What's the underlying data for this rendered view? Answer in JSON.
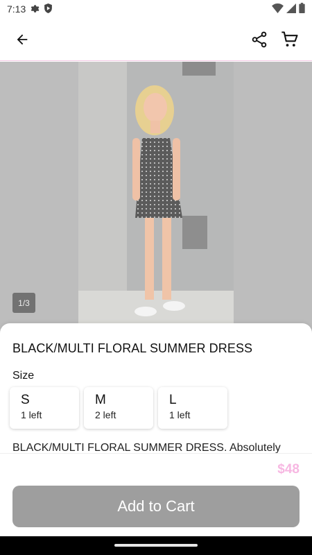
{
  "status_bar": {
    "time": "7:13",
    "icons": [
      "gear-icon",
      "shield-play-icon",
      "wifi-icon",
      "signal-icon",
      "battery-icon"
    ]
  },
  "app_bar": {
    "back_icon": "arrow-left-icon",
    "share_icon": "share-icon",
    "cart_icon": "cart-icon"
  },
  "gallery": {
    "counter": "1/3"
  },
  "product": {
    "title": "BLACK/MULTI FLORAL SUMMER DRESS",
    "size_label": "Size",
    "sizes": [
      {
        "code": "S",
        "stock": "1 left"
      },
      {
        "code": "M",
        "stock": "2 left"
      },
      {
        "code": "L",
        "stock": "1 left"
      }
    ],
    "description": "BLACK/MULTI FLORAL SUMMER DRESS. Absolutely"
  },
  "footer": {
    "price": "$48",
    "add_to_cart": "Add to Cart"
  },
  "colors": {
    "price": "#f7b7e2",
    "button": "#9e9e9e",
    "divider": "#f3c7e3"
  }
}
